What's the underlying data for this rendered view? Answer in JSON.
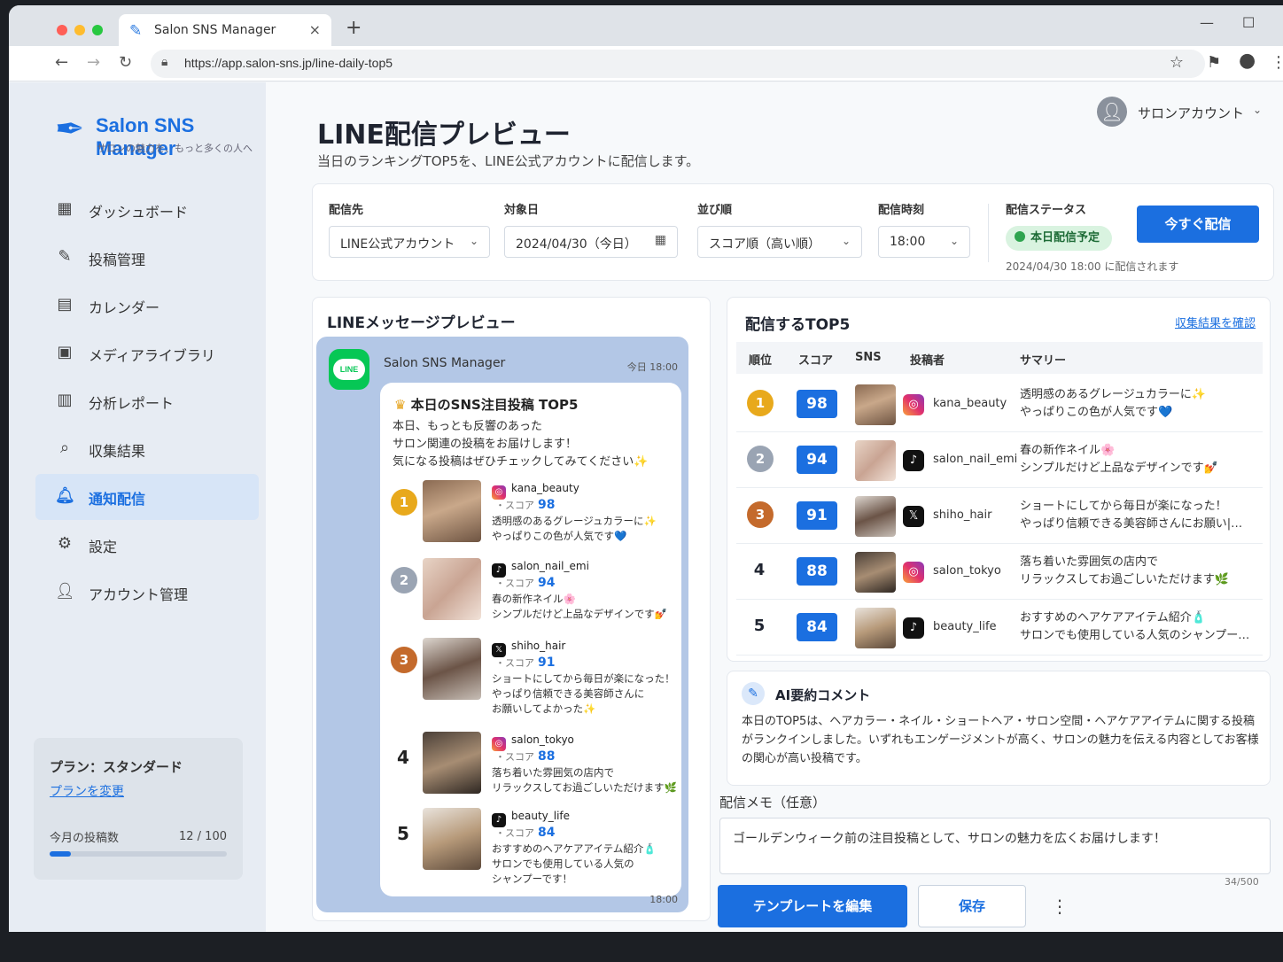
{
  "browser": {
    "tab_title": "Salon SNS Manager",
    "url": "https://app.salon-sns.jp/line-daily-top5"
  },
  "brand": {
    "name": "Salon SNS Manager",
    "tagline": "サロンの魅力を、もっと多くの人へ",
    "color": "#1b6fe0"
  },
  "sidebar": {
    "items": [
      {
        "label": "ダッシュボード",
        "icon": "dashboard-icon"
      },
      {
        "label": "投稿管理",
        "icon": "post-edit-icon"
      },
      {
        "label": "カレンダー",
        "icon": "calendar-icon"
      },
      {
        "label": "メディアライブラリ",
        "icon": "image-icon"
      },
      {
        "label": "分析レポート",
        "icon": "bar-chart-icon"
      },
      {
        "label": "収集結果",
        "icon": "search-icon"
      },
      {
        "label": "通知配信",
        "icon": "bell-icon",
        "active": true
      },
      {
        "label": "設定",
        "icon": "gear-icon"
      },
      {
        "label": "アカウント管理",
        "icon": "user-icon"
      }
    ],
    "plan": {
      "name": "プラン：スタンダード",
      "change_link": "プランを変更",
      "usage_label": "今月の投稿数",
      "usage_value": "12 / 100",
      "usage_fraction": 0.12
    }
  },
  "header": {
    "account_name": "サロンアカウント",
    "title": "LINE配信プレビュー",
    "subtitle": "当日のランキングTOP5を、LINE公式アカウントに配信します。"
  },
  "filters": {
    "destination": {
      "label": "配信先",
      "value": "LINE公式アカウント"
    },
    "date": {
      "label": "対象日",
      "value": "2024/04/30（今日）"
    },
    "order": {
      "label": "並び順",
      "value": "スコア順（高い順）"
    },
    "time": {
      "label": "配信時刻",
      "value": "18:00"
    },
    "status": {
      "label": "配信ステータス",
      "value": "本日配信予定",
      "note": "2024/04/30 18:00 に配信されます"
    },
    "send_now": "今すぐ配信"
  },
  "preview": {
    "heading": "LINEメッセージプレビュー",
    "line_icon_text": "LINE",
    "sender": "Salon SNS Manager",
    "top_time": "今日 18:00",
    "bubble_title": "本日のSNS注目投稿 TOP5",
    "intro": [
      "本日、もっとも反響のあった",
      "サロン関連の投稿をお届けします！",
      "気になる投稿はぜひチェックしてみてください✨"
    ],
    "score_label": "・スコア",
    "entries": [
      {
        "rank": "1",
        "sns": "ig",
        "user": "kana_beauty",
        "score": "98",
        "summary": [
          "透明感のあるグレージュカラーに✨",
          "やっぱりこの色が人気です💙"
        ]
      },
      {
        "rank": "2",
        "sns": "tt",
        "user": "salon_nail_emi",
        "score": "94",
        "summary": [
          "春の新作ネイル🌸",
          "シンプルだけど上品なデザインです💅"
        ]
      },
      {
        "rank": "3",
        "sns": "xx",
        "user": "shiho_hair",
        "score": "91",
        "summary": [
          "ショートにしてから毎日が楽になった！",
          "やっぱり信頼できる美容師さんに",
          "お願いしてよかった✨"
        ]
      },
      {
        "rank": "4",
        "sns": "ig",
        "user": "salon_tokyo",
        "score": "88",
        "summary": [
          "落ち着いた雰囲気の店内で",
          "リラックスしてお過ごしいただけます🌿"
        ]
      },
      {
        "rank": "5",
        "sns": "tt",
        "user": "beauty_life",
        "score": "84",
        "summary": [
          "おすすめのヘアケアアイテム紹介🧴",
          "サロンでも使用している人気の",
          "シャンプーです！"
        ]
      }
    ],
    "bottom_time": "18:00"
  },
  "top5": {
    "heading": "配信するTOP5",
    "link": "収集結果を確認",
    "columns": [
      "順位",
      "スコア",
      "SNS",
      "投稿者",
      "サマリー"
    ],
    "rows": [
      {
        "rank": "1",
        "score": "98",
        "sns": "ig",
        "user": "kana_beauty",
        "summary": [
          "透明感のあるグレージュカラーに✨",
          "やっぱりこの色が人気です💙"
        ]
      },
      {
        "rank": "2",
        "score": "94",
        "sns": "tt",
        "user": "salon_nail_emi",
        "summary": [
          "春の新作ネイル🌸",
          "シンプルだけど上品なデザインです💅"
        ]
      },
      {
        "rank": "3",
        "score": "91",
        "sns": "xx",
        "user": "shiho_hair",
        "summary": [
          "ショートにしてから毎日が楽になった！",
          "やっぱり信頼できる美容師さんにお願い|…"
        ]
      },
      {
        "rank": "4",
        "score": "88",
        "sns": "ig",
        "user": "salon_tokyo",
        "summary": [
          "落ち着いた雰囲気の店内で",
          "リラックスしてお過ごしいただけます🌿"
        ]
      },
      {
        "rank": "5",
        "score": "84",
        "sns": "tt",
        "user": "beauty_life",
        "summary": [
          "おすすめのヘアケアアイテム紹介🧴",
          "サロンでも使用している人気のシャンプー…"
        ]
      }
    ]
  },
  "ai": {
    "heading": "AI要約コメント",
    "body": "本日のTOP5は、ヘアカラー・ネイル・ショートヘア・サロン空間・ヘアケアアイテムに関する投稿がランクインしました。いずれもエンゲージメントが高く、サロンの魅力を伝える内容としてお客様の関心が高い投稿です。"
  },
  "memo": {
    "label": "配信メモ（任意）",
    "value": "ゴールデンウィーク前の注目投稿として、サロンの魅力を広くお届けします！",
    "counter": "34/500"
  },
  "actions": {
    "edit_template": "テンプレートを編集",
    "save": "保存"
  }
}
